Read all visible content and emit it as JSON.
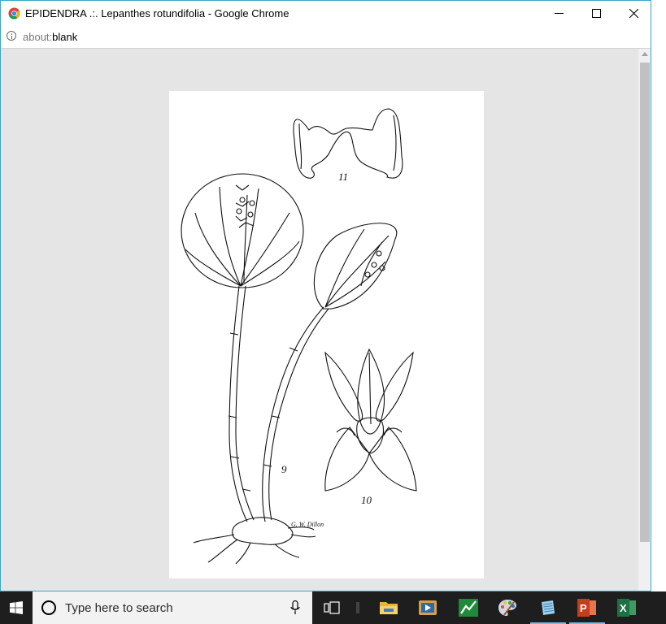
{
  "window": {
    "title": "EPIDENDRA .:. Lepanthes rotundifolia - Google Chrome"
  },
  "address": {
    "scheme": "about:",
    "path": "blank"
  },
  "artwork": {
    "label_fig11": "11",
    "label_fig9": "9",
    "label_fig10": "10",
    "signature": "G. W. Dillon"
  },
  "taskbar": {
    "search_placeholder": "Type here to search",
    "apps": [
      "file-explorer",
      "media-player",
      "stock-chart-app",
      "paint",
      "notepad",
      "powerpoint",
      "excel"
    ]
  },
  "colors": {
    "window_border": "#3aa7c7",
    "viewport_bg": "#e5e5e5",
    "taskbar_bg": "#1e1e1e",
    "powerpoint": "#c43e1c",
    "excel": "#1e7145",
    "active_indicator": "#76b9ed"
  }
}
